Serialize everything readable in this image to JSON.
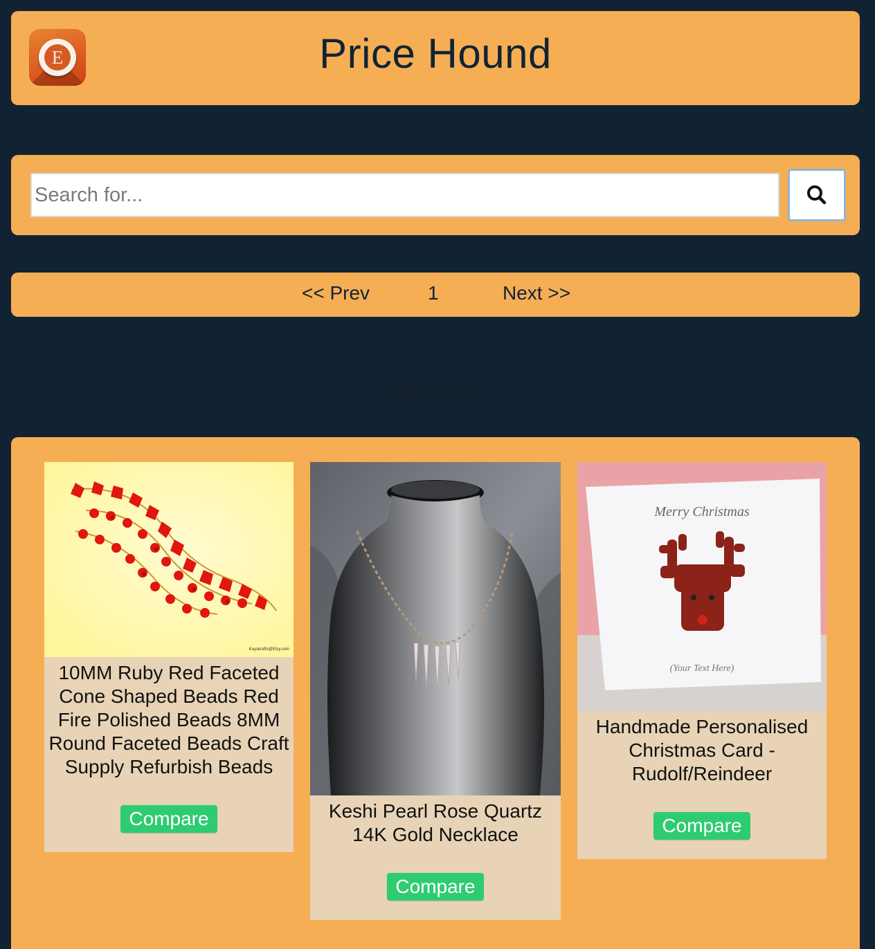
{
  "header": {
    "logo_letter": "E",
    "title": "Price Hound"
  },
  "search": {
    "placeholder": "Search for...",
    "button_icon": "search-icon"
  },
  "pagination": {
    "prev_label": "<< Prev",
    "current_page": "1",
    "next_label": ">> ",
    "next_text": "Next >>"
  },
  "results": {
    "heading": "Results",
    "items": [
      {
        "name": "10MM Ruby Red Faceted Cone Shaped Beads Red Fire Polished Beads 8MM Round Faceted Beads Craft Supply Refurbish Beads",
        "compare_label": "Compare",
        "image_caption": "Kayskrafts@Etsy.com"
      },
      {
        "name": "Keshi Pearl Rose Quartz 14K Gold Necklace",
        "compare_label": "Compare"
      },
      {
        "name": "Handmade Personalised Christmas Card - Rudolf/Reindeer",
        "compare_label": "Compare",
        "image_text_top": "Merry Christmas",
        "image_text_bottom": "(Your Text Here)"
      }
    ]
  },
  "colors": {
    "background": "#112333",
    "panel": "#f5ae54",
    "card": "#e8d3b6",
    "compare_button": "#2ecc71",
    "logo": "#d9531d"
  }
}
